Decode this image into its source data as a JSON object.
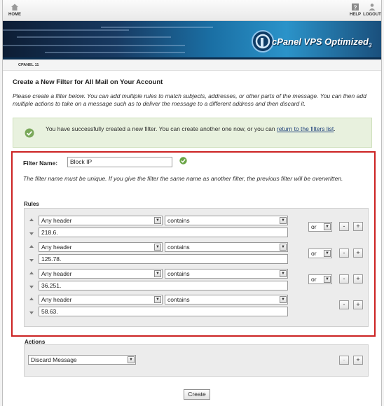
{
  "nav": {
    "home": "HOME",
    "help": "HELP",
    "logout": "LOGOUT"
  },
  "banner": {
    "brand": "cPanel VPS Optimized",
    "version": "3"
  },
  "breadcrumb": "CPANEL 11",
  "page": {
    "title": "Create a New Filter for All Mail on Your Account",
    "intro": "Please create a filter below. You can add multiple rules to match subjects, addresses, or other parts of the message. You can then add multiple actions to take on a message such as to deliver the message to a different address and then discard it."
  },
  "success": {
    "text": "You have successfully created a new filter. You can create another one now, or you can ",
    "link": "return to the filters list",
    "tail": "."
  },
  "filter": {
    "label": "Filter Name:",
    "value": "Block IP",
    "note": "The filter name must be unique. If you give the filter the same name as another filter, the previous filter will be overwritten."
  },
  "rules": {
    "label": "Rules",
    "items": [
      {
        "header": "Any header",
        "match": "contains",
        "value": "218.6.",
        "op": "or"
      },
      {
        "header": "Any header",
        "match": "contains",
        "value": "125.78.",
        "op": "or"
      },
      {
        "header": "Any header",
        "match": "contains",
        "value": "36.251.",
        "op": "or"
      },
      {
        "header": "Any header",
        "match": "contains",
        "value": "58.63.",
        "op": ""
      }
    ]
  },
  "actions": {
    "label": "Actions",
    "selected": "Discard Message"
  },
  "buttons": {
    "minus": "-",
    "plus": "+",
    "create": "Create",
    "dropdown": "▼"
  },
  "colors": {
    "highlight_border": "#cc2222",
    "success_bg": "#e8f1de",
    "banner_blue": "#1a6fa4"
  }
}
